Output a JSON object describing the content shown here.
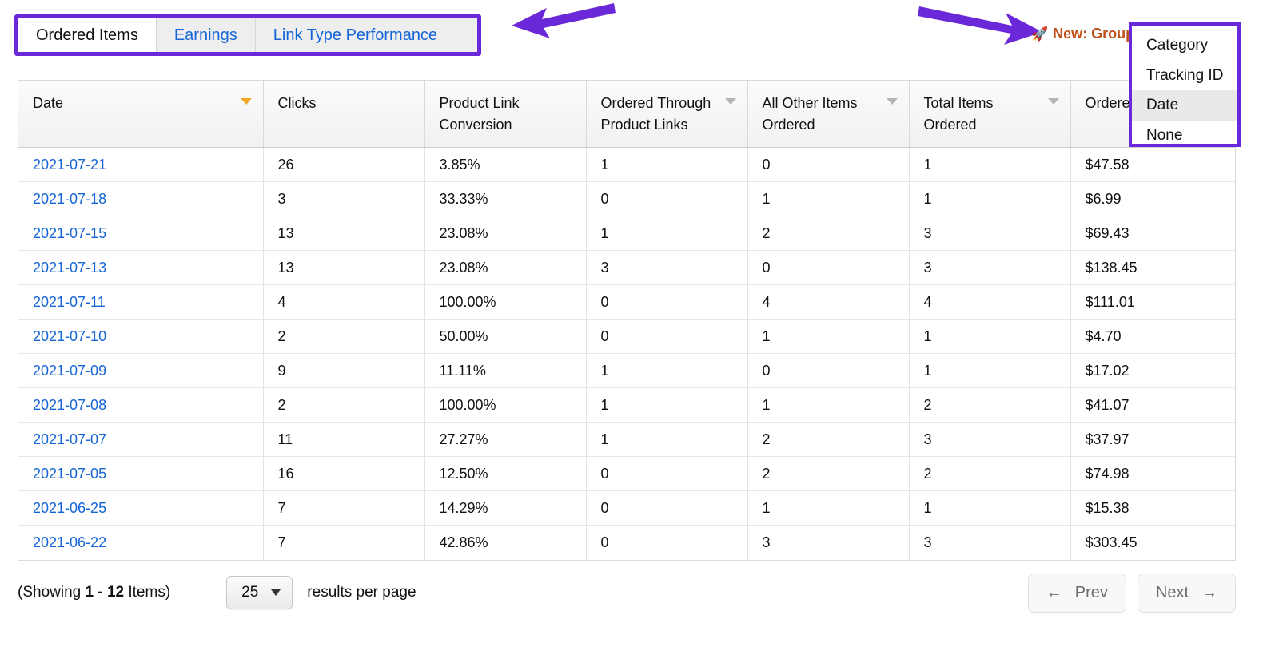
{
  "tabs": [
    {
      "label": "Ordered Items",
      "active": true
    },
    {
      "label": "Earnings",
      "active": false
    },
    {
      "label": "Link Type Performance",
      "active": false
    }
  ],
  "new_badge": {
    "icon": "rocket-icon",
    "glyph": "🚀",
    "text": "New: Group",
    "color": "#c0501a"
  },
  "group_dropdown": {
    "items": [
      {
        "label": "Category",
        "selected": false
      },
      {
        "label": "Tracking ID",
        "selected": false
      },
      {
        "label": "Date",
        "selected": true
      },
      {
        "label": "None",
        "selected": false
      }
    ]
  },
  "annotations": {
    "accent_color": "#6b28d9",
    "arrow_left": "left-pointing-arrow",
    "arrow_right": "right-pointing-arrow"
  },
  "table": {
    "columns": [
      {
        "label": "Date",
        "sort": "active"
      },
      {
        "label": "Clicks",
        "sort": "none"
      },
      {
        "label": "Product Link Conversion",
        "sort": "none"
      },
      {
        "label": "Ordered Through Product Links",
        "sort": "inactive"
      },
      {
        "label": "All Other Items Ordered",
        "sort": "inactive"
      },
      {
        "label": "Total Items Ordered",
        "sort": "inactive"
      },
      {
        "label": "Ordered",
        "sort": "inactive"
      }
    ],
    "rows": [
      {
        "date": "2021-07-21",
        "clicks": "26",
        "conversion": "3.85%",
        "through_links": "1",
        "other_items": "0",
        "total_items": "1",
        "revenue": "$47.58"
      },
      {
        "date": "2021-07-18",
        "clicks": "3",
        "conversion": "33.33%",
        "through_links": "0",
        "other_items": "1",
        "total_items": "1",
        "revenue": "$6.99"
      },
      {
        "date": "2021-07-15",
        "clicks": "13",
        "conversion": "23.08%",
        "through_links": "1",
        "other_items": "2",
        "total_items": "3",
        "revenue": "$69.43"
      },
      {
        "date": "2021-07-13",
        "clicks": "13",
        "conversion": "23.08%",
        "through_links": "3",
        "other_items": "0",
        "total_items": "3",
        "revenue": "$138.45"
      },
      {
        "date": "2021-07-11",
        "clicks": "4",
        "conversion": "100.00%",
        "through_links": "0",
        "other_items": "4",
        "total_items": "4",
        "revenue": "$111.01"
      },
      {
        "date": "2021-07-10",
        "clicks": "2",
        "conversion": "50.00%",
        "through_links": "0",
        "other_items": "1",
        "total_items": "1",
        "revenue": "$4.70"
      },
      {
        "date": "2021-07-09",
        "clicks": "9",
        "conversion": "11.11%",
        "through_links": "1",
        "other_items": "0",
        "total_items": "1",
        "revenue": "$17.02"
      },
      {
        "date": "2021-07-08",
        "clicks": "2",
        "conversion": "100.00%",
        "through_links": "1",
        "other_items": "1",
        "total_items": "2",
        "revenue": "$41.07"
      },
      {
        "date": "2021-07-07",
        "clicks": "11",
        "conversion": "27.27%",
        "through_links": "1",
        "other_items": "2",
        "total_items": "3",
        "revenue": "$37.97"
      },
      {
        "date": "2021-07-05",
        "clicks": "16",
        "conversion": "12.50%",
        "through_links": "0",
        "other_items": "2",
        "total_items": "2",
        "revenue": "$74.98"
      },
      {
        "date": "2021-06-25",
        "clicks": "7",
        "conversion": "14.29%",
        "through_links": "0",
        "other_items": "1",
        "total_items": "1",
        "revenue": "$15.38"
      },
      {
        "date": "2021-06-22",
        "clicks": "7",
        "conversion": "42.86%",
        "through_links": "0",
        "other_items": "3",
        "total_items": "3",
        "revenue": "$303.45"
      }
    ]
  },
  "footer": {
    "showing_prefix": "(Showing ",
    "showing_range": "1 - 12",
    "showing_suffix": " Items)",
    "per_page_value": "25",
    "per_page_label": "results per page",
    "prev_label": "Prev",
    "next_label": "Next",
    "prev_arrow": "←",
    "next_arrow": "→"
  }
}
